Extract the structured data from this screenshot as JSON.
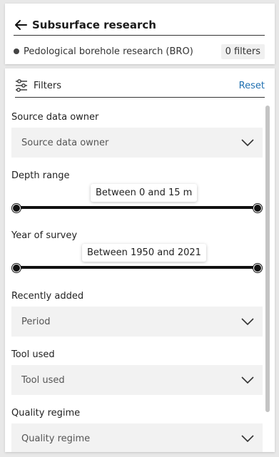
{
  "header": {
    "title": "Subsurface research",
    "back_icon": "arrow-left-icon",
    "subject": "Pedological borehole research (BRO)",
    "filter_count": "0 filters"
  },
  "filters": {
    "heading": "Filters",
    "reset": "Reset",
    "source_owner": {
      "label": "Source data owner",
      "value": "Source data owner"
    },
    "depth_range": {
      "label": "Depth range",
      "tooltip": "Between 0 and 15 m",
      "min": 0,
      "max": 15
    },
    "year_of_survey": {
      "label": "Year of survey",
      "tooltip": "Between 1950 and 2021",
      "min": 1950,
      "max": 2021
    },
    "recently_added": {
      "label": "Recently added",
      "value": "Period"
    },
    "tool_used": {
      "label": "Tool used",
      "value": "Tool used"
    },
    "quality_regime": {
      "label": "Quality regime",
      "value": "Quality regime"
    }
  }
}
